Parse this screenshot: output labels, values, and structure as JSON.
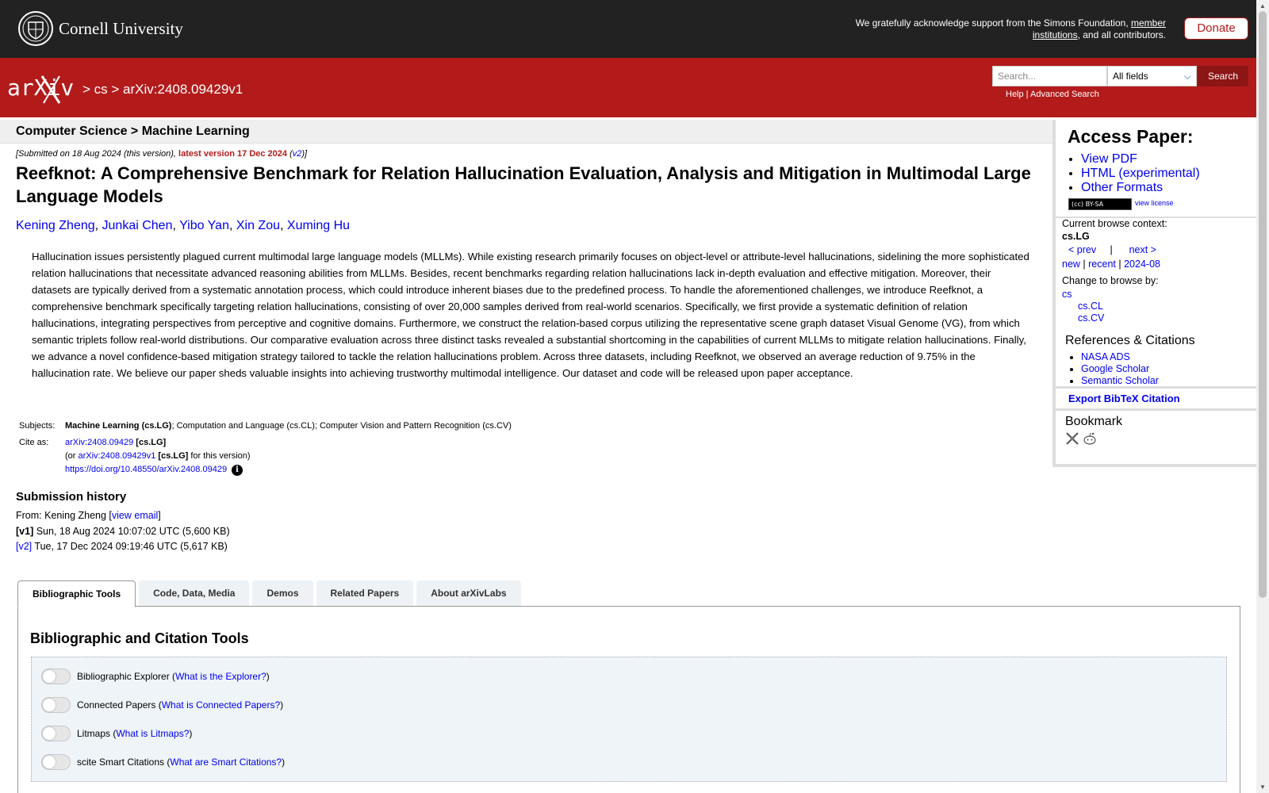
{
  "topbar": {
    "institution": "Cornell University",
    "support_text_1": "We gratefully acknowledge support from the Simons Foundation, ",
    "support_link": "member institutions",
    "support_text_2": ", and all contributors.",
    "donate_label": "Donate"
  },
  "header": {
    "logo": "arXiv",
    "breadcrumb_sep1": " > ",
    "breadcrumb_cs": "cs",
    "breadcrumb_sep2": " > ",
    "breadcrumb_id": "arXiv:2408.09429v1",
    "search_placeholder": "Search...",
    "field_selected": "All fields",
    "search_button": "Search",
    "help_label": "Help",
    "help_sep": " | ",
    "advanced_label": "Advanced Search"
  },
  "subheader": {
    "subject_path": "Computer Science > Machine Learning"
  },
  "paper": {
    "dateline_1": "[Submitted on 18 Aug 2024 (this version), ",
    "dateline_latest": "latest version 17 Dec 2024",
    "dateline_2": " (",
    "dateline_v2": "v2",
    "dateline_3": ")]",
    "title": "Reefknot: A Comprehensive Benchmark for Relation Hallucination Evaluation, Analysis and Mitigation in Multimodal Large Language Models",
    "authors": [
      "Kening Zheng",
      "Junkai Chen",
      "Yibo Yan",
      "Xin Zou",
      "Xuming Hu"
    ],
    "abstract": "Hallucination issues persistently plagued current multimodal large language models (MLLMs). While existing research primarily focuses on object-level or attribute-level hallucinations, sidelining the more sophisticated relation hallucinations that necessitate advanced reasoning abilities from MLLMs. Besides, recent benchmarks regarding relation hallucinations lack in-depth evaluation and effective mitigation. Moreover, their datasets are typically derived from a systematic annotation process, which could introduce inherent biases due to the predefined process. To handle the aforementioned challenges, we introduce Reefknot, a comprehensive benchmark specifically targeting relation hallucinations, consisting of over 20,000 samples derived from real-world scenarios. Specifically, we first provide a systematic definition of relation hallucinations, integrating perspectives from perceptive and cognitive domains. Furthermore, we construct the relation-based corpus utilizing the representative scene graph dataset Visual Genome (VG), from which semantic triplets follow real-world distributions. Our comparative evaluation across three distinct tasks revealed a substantial shortcoming in the capabilities of current MLLMs to mitigate relation hallucinations. Finally, we advance a novel confidence-based mitigation strategy tailored to tackle the relation hallucinations problem. Across three datasets, including Reefknot, we observed an average reduction of 9.75% in the hallucination rate. We believe our paper sheds valuable insights into achieving trustworthy multimodal intelligence. Our dataset and code will be released upon paper acceptance.",
    "subjects_label": "Subjects:",
    "subjects_primary": "Machine Learning (cs.LG)",
    "subjects_rest": "; Computation and Language (cs.CL); Computer Vision and Pattern Recognition (cs.CV)",
    "cite_label": "Cite as:",
    "cite_id": "arXiv:2408.09429",
    "cite_cat": " [cs.LG]",
    "cite_or": "(or ",
    "cite_version_id": "arXiv:2408.09429v1",
    "cite_version_cat": " [cs.LG]",
    "cite_version_tail": " for this version)",
    "doi": "https://doi.org/10.48550/arXiv.2408.09429",
    "info_icon": "i"
  },
  "history": {
    "title": "Submission history",
    "from_label": "From: Kening Zheng [",
    "view_email": "view email",
    "from_close": "]",
    "v1_label": "[v1]",
    "v1_text": " Sun, 18 Aug 2024 10:07:02 UTC (5,600 KB)",
    "v2_label": "[v2]",
    "v2_text": " Tue, 17 Dec 2024 09:19:46 UTC (5,617 KB)"
  },
  "tabs": [
    "Bibliographic Tools",
    "Code, Data, Media",
    "Demos",
    "Related Papers",
    "About arXivLabs"
  ],
  "tools": {
    "title": "Bibliographic and Citation Tools",
    "items": [
      {
        "label": "Bibliographic Explorer (",
        "link": "What is the Explorer?",
        "close": ")"
      },
      {
        "label": "Connected Papers (",
        "link": "What is Connected Papers?",
        "close": ")"
      },
      {
        "label": "Litmaps (",
        "link": "What is Litmaps?",
        "close": ")"
      },
      {
        "label": "scite Smart Citations (",
        "link": "What are Smart Citations?",
        "close": ")"
      }
    ]
  },
  "sidebar": {
    "access_title": "Access Paper:",
    "access_links": [
      "View PDF",
      "HTML (experimental)",
      "Other Formats"
    ],
    "license_badge": "(cc) BY-SA",
    "view_license": "view license",
    "context_label": "Current browse context:",
    "context_value": "cs.LG",
    "prev": "< prev",
    "nav_sep": "|",
    "next": "next >",
    "new": "new",
    "recent": "recent",
    "month": "2024-08",
    "change_label": "Change to browse by:",
    "browse_cs": "cs",
    "browse_cscl": "cs.CL",
    "browse_cscv": "cs.CV",
    "refs_title": "References & Citations",
    "refs_links": [
      "NASA ADS",
      "Google Scholar",
      "Semantic Scholar"
    ],
    "bibtex": "Export BibTeX Citation",
    "bookmark_title": "Bookmark"
  }
}
